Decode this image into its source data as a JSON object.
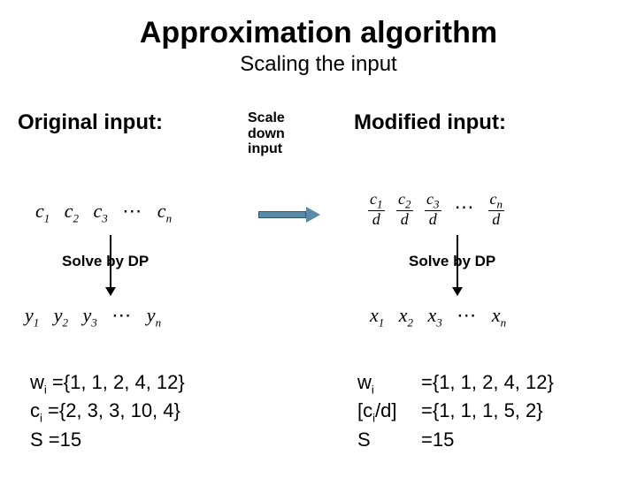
{
  "title": "Approximation algorithm",
  "subtitle": "Scaling the input",
  "left": {
    "header": "Original input:",
    "solve": "Solve by DP",
    "seq_c": {
      "v1": "c",
      "s1": "1",
      "v2": "c",
      "s2": "2",
      "v3": "c",
      "s3": "3",
      "dots": "⋯",
      "vn": "c",
      "sn": "n"
    },
    "seq_y": {
      "v1": "y",
      "s1": "1",
      "v2": "y",
      "s2": "2",
      "v3": "y",
      "s3": "3",
      "dots": "⋯",
      "vn": "y",
      "sn": "n"
    },
    "vals": {
      "w_lab": "w",
      "w_sub": "i",
      "w_eq": " ={1, 1, 2, 4, 12}",
      "c_lab": "c",
      "c_sub": "i",
      "c_eq": " ={2, 3, 3, 10, 4}",
      "s_lab": "S",
      "s_eq": "  =15"
    }
  },
  "mid": {
    "label_l1": "Scale",
    "label_l2": "down",
    "label_l3": "input"
  },
  "right": {
    "header": "Modified input:",
    "solve": "Solve by DP",
    "seq_cd": {
      "n1": "c",
      "ns1": "1",
      "n2": "c",
      "ns2": "2",
      "n3": "c",
      "ns3": "3",
      "dots": "⋯",
      "nn": "c",
      "nsn": "n",
      "den": "d"
    },
    "seq_x": {
      "v1": "x",
      "s1": "1",
      "v2": "x",
      "s2": "2",
      "v3": "x",
      "s3": "3",
      "dots": "⋯",
      "vn": "x",
      "sn": "n"
    },
    "vals": {
      "w_lab": "w",
      "w_sub": "i",
      "w_eq": "={1, 1, 2, 4, 12}",
      "c_lab": "[c",
      "c_sub": "i",
      "c_lab2": "/d]",
      "c_eq": "={1, 1, 1, 5, 2}",
      "s_lab": "S",
      "s_eq": "=15"
    }
  }
}
